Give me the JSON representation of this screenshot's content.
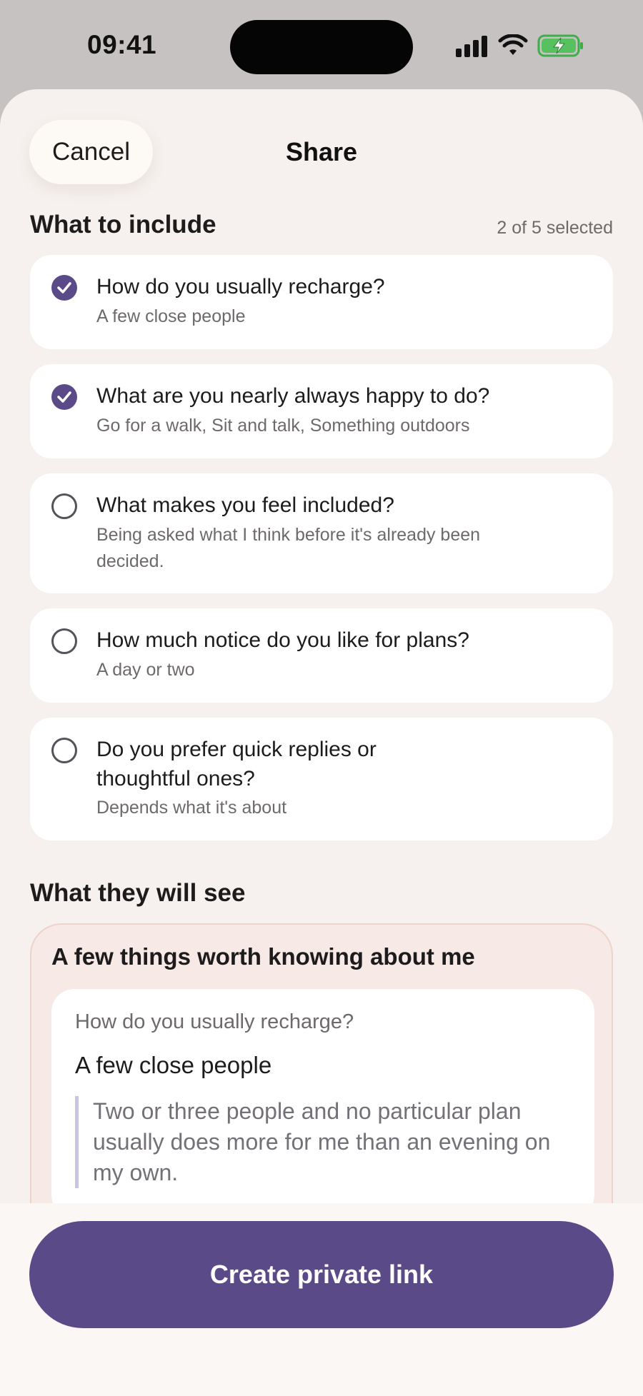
{
  "status_bar": {
    "time": "09:41"
  },
  "header": {
    "cancel_label": "Cancel",
    "title": "Share"
  },
  "include": {
    "heading": "What to include",
    "selected_count": "2 of 5 selected",
    "options": [
      {
        "question": "How do you usually recharge?",
        "answer": "A few close people",
        "checked": true
      },
      {
        "question": "What are you nearly always happy to do?",
        "answer": "Go for a walk, Sit and talk, Something outdoors",
        "checked": true
      },
      {
        "question": "What makes you feel included?",
        "answer": "Being asked what I think before it's already been decided.",
        "checked": false
      },
      {
        "question": "How much notice do you like for plans?",
        "answer": "A day or two",
        "checked": false
      },
      {
        "question": "Do you prefer quick replies or thoughtful ones?",
        "answer": "Depends what it's about",
        "checked": false
      }
    ]
  },
  "preview": {
    "heading": "What they will see",
    "title": "A few things worth knowing about me",
    "card": {
      "question": "How do you usually recharge?",
      "answer": "A few close people",
      "note": "Two or three people and no particular plan usually does more for me than an evening on my own."
    }
  },
  "action": {
    "create_label": "Create private link"
  },
  "colors": {
    "accent": "#5b4a88",
    "sheet_bg": "#f6f1ef",
    "preview_bg": "#f6e9e6"
  }
}
